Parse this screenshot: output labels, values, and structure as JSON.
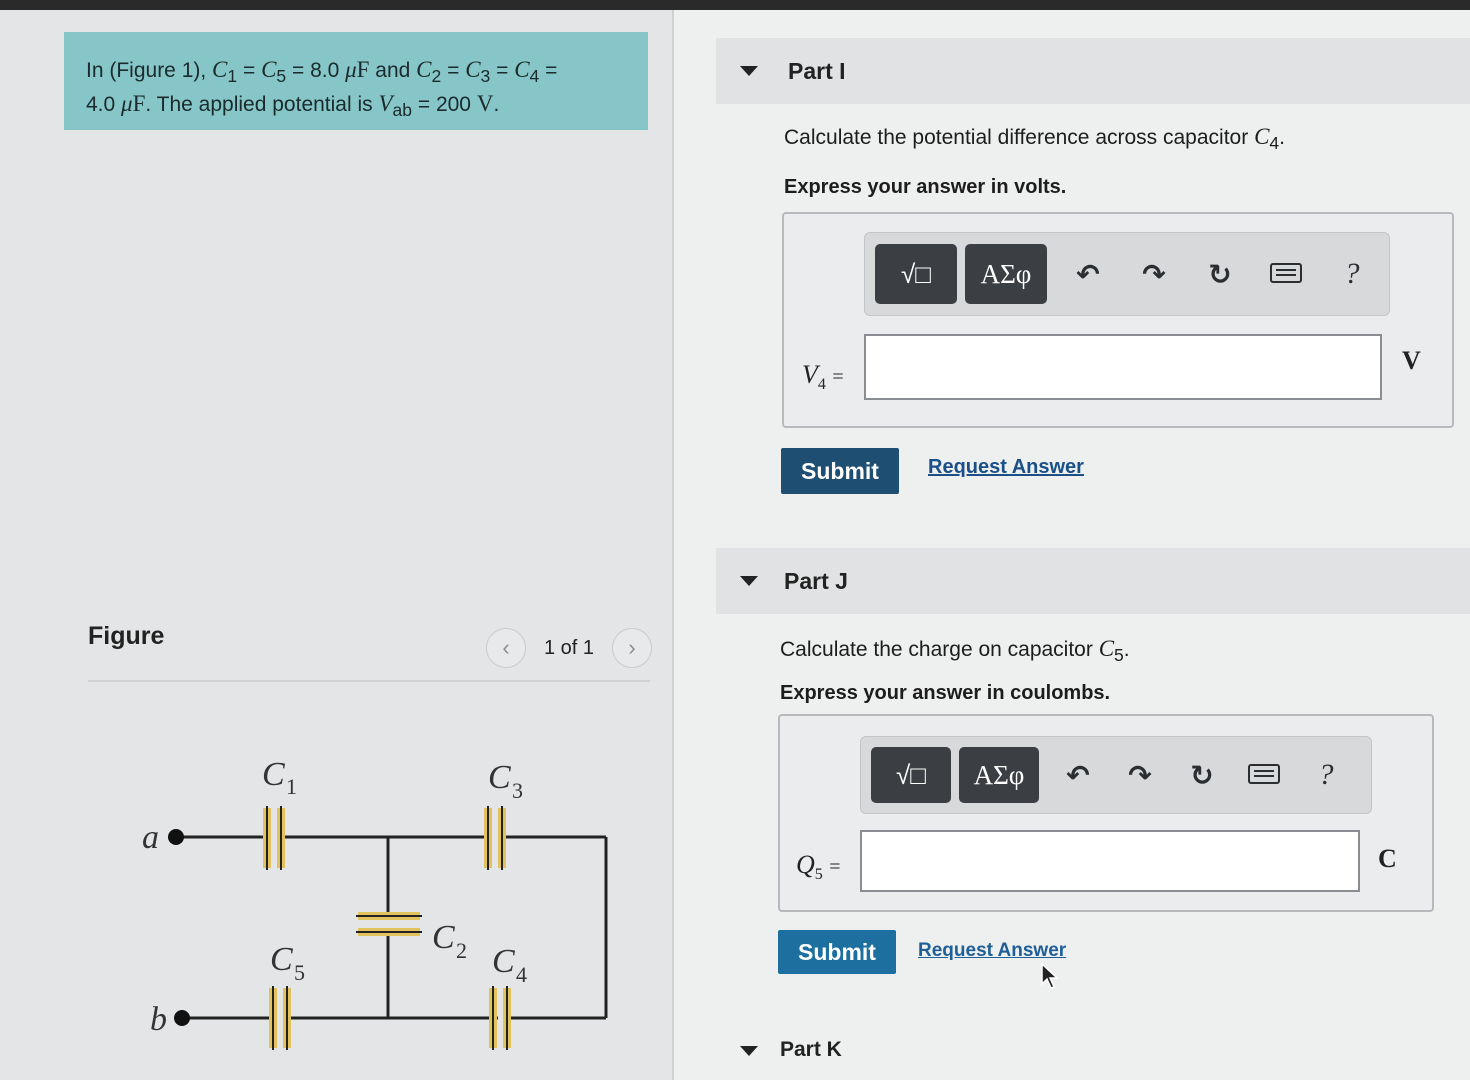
{
  "problem": {
    "text_parts": [
      "In (Figure 1), ",
      "C",
      "1",
      " = ",
      "C",
      "5",
      " = 8.0 ",
      "μ",
      "F",
      " and ",
      "C",
      "2",
      " = ",
      "C",
      "3",
      " = ",
      "C",
      "4",
      " = ",
      "4.0 ",
      "μ",
      "F",
      ". The applied potential is ",
      "V",
      "ab",
      " = 200 ",
      "V",
      "."
    ]
  },
  "figure": {
    "label": "Figure",
    "page": "1 of 1",
    "prev_icon": "‹",
    "next_icon": "›",
    "circuit_labels": {
      "a": "a",
      "b": "b",
      "c1": "C",
      "c1_sub": "1",
      "c2": "C",
      "c2_sub": "2",
      "c3": "C",
      "c3_sub": "3",
      "c4": "C",
      "c4_sub": "4",
      "c5": "C",
      "c5_sub": "5"
    }
  },
  "parts": [
    {
      "title": "Part I",
      "question": "Calculate the potential difference across capacitor ",
      "question_var": "C",
      "question_sub": "4",
      "question_end": ".",
      "instruction": "Express your answer in volts.",
      "var": "V",
      "var_sub": "4",
      "equals": "=",
      "unit": "V",
      "input_value": "",
      "submit": "Submit",
      "request": "Request Answer"
    },
    {
      "title": "Part J",
      "question": "Calculate the charge on capacitor ",
      "question_var": "C",
      "question_sub": "5",
      "question_end": ".",
      "instruction": "Express your answer in coulombs.",
      "var": "Q",
      "var_sub": "5",
      "equals": "=",
      "unit": "C",
      "input_value": "",
      "submit": "Submit",
      "request": "Request Answer"
    },
    {
      "title": "Part K"
    }
  ],
  "toolbar": {
    "template_icon": "√□",
    "greek": "ΑΣφ",
    "undo": "↶",
    "redo": "↷",
    "reset": "↻",
    "help": "?"
  },
  "colors": {
    "problem_bg": "#86c6c8",
    "submit_part_i": "#1f4e73",
    "submit_part_j": "#1c6f9e",
    "link": "#1a4f87",
    "capacitor_plate": "#e2c25c"
  }
}
